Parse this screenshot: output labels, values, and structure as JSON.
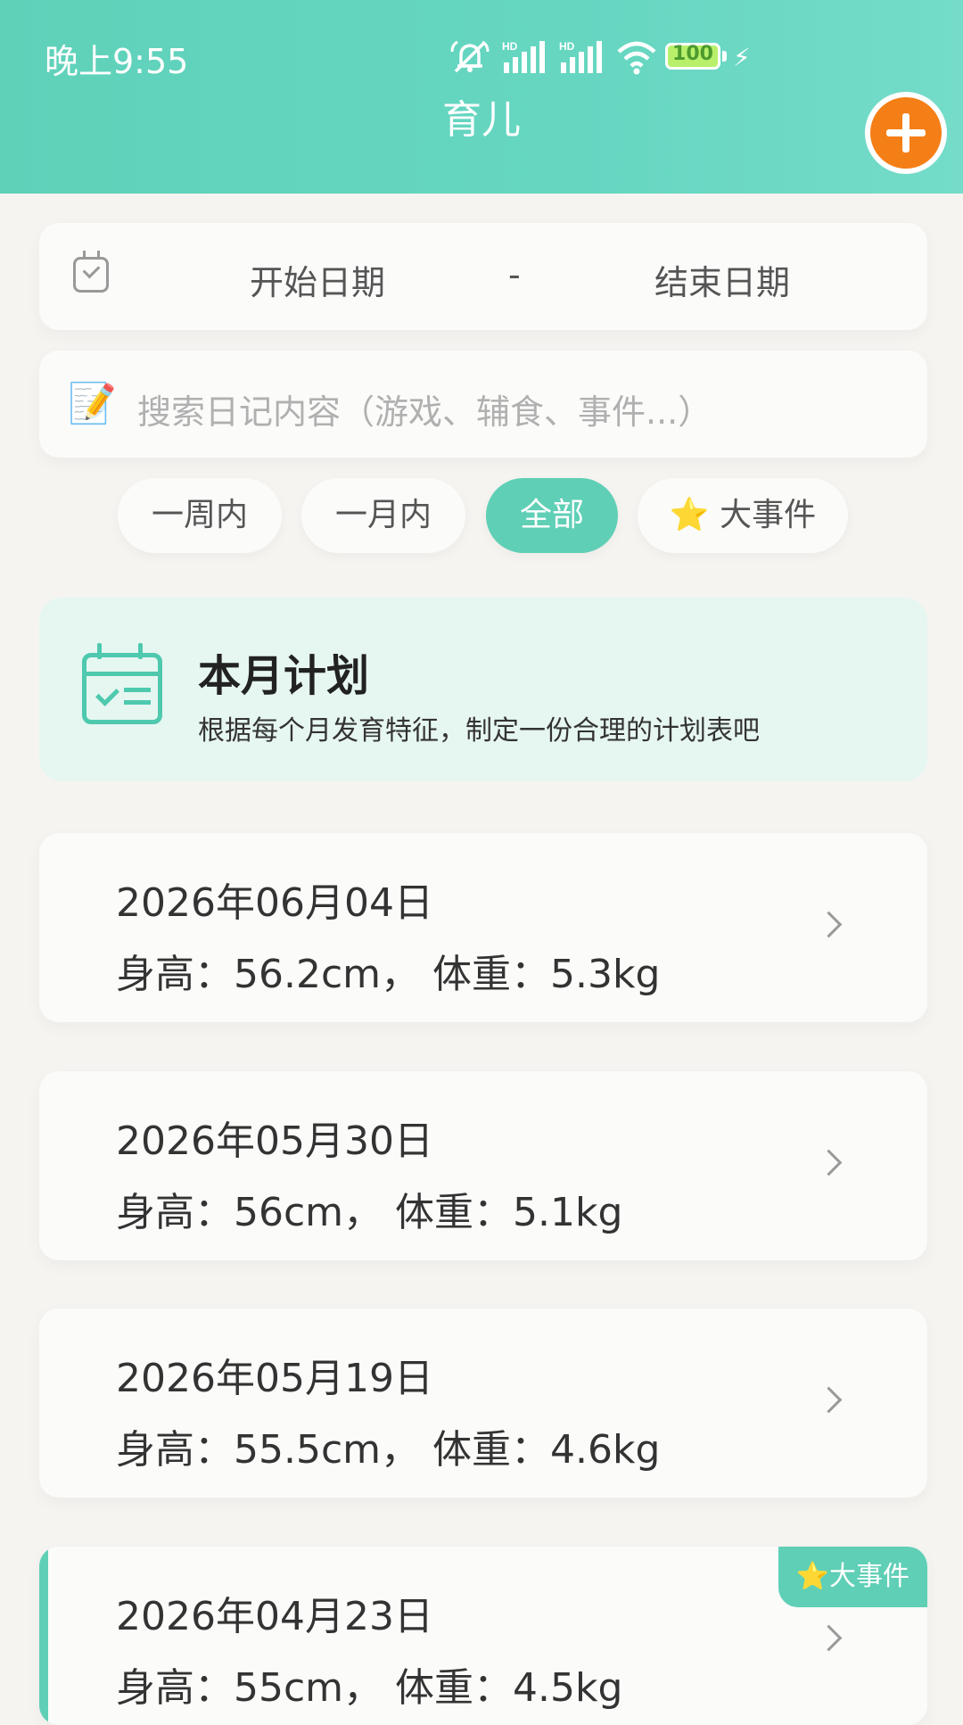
{
  "status_bar": {
    "time": "晚上9:55",
    "battery": "100",
    "icons": [
      "mute-icon",
      "hd-signal-icon",
      "hd-signal-icon",
      "wifi-icon",
      "battery-icon",
      "charging-icon"
    ]
  },
  "header": {
    "title": "育儿",
    "add_button_icon": "plus-icon",
    "accent_color": "#5fcfb6",
    "add_color": "#f47f16"
  },
  "date_filter": {
    "icon": "calendar-check-icon",
    "start_label": "开始日期",
    "separator": "-",
    "end_label": "结束日期"
  },
  "search": {
    "icon": "memo-icon",
    "placeholder": "搜索日记内容（游戏、辅食、事件...）"
  },
  "filters": [
    {
      "label": "一周内",
      "active": false
    },
    {
      "label": "一月内",
      "active": false
    },
    {
      "label": "全部",
      "active": true
    },
    {
      "label": "⭐ 大事件",
      "active": false
    }
  ],
  "plan": {
    "icon": "calendar-list-icon",
    "title": "本月计划",
    "subtitle": "根据每个月发育特征，制定一份合理的计划表吧"
  },
  "records": [
    {
      "date": "2026年06月04日",
      "measurement": "身高：56.2cm， 体重：5.3kg",
      "major_event": false
    },
    {
      "date": "2026年05月30日",
      "measurement": "身高：56cm， 体重：5.1kg",
      "major_event": false
    },
    {
      "date": "2026年05月19日",
      "measurement": "身高：55.5cm， 体重：4.6kg",
      "major_event": false
    },
    {
      "date": "2026年04月23日",
      "measurement": "身高：55cm， 体重：4.5kg",
      "major_event": true,
      "badge": "⭐大事件"
    }
  ]
}
